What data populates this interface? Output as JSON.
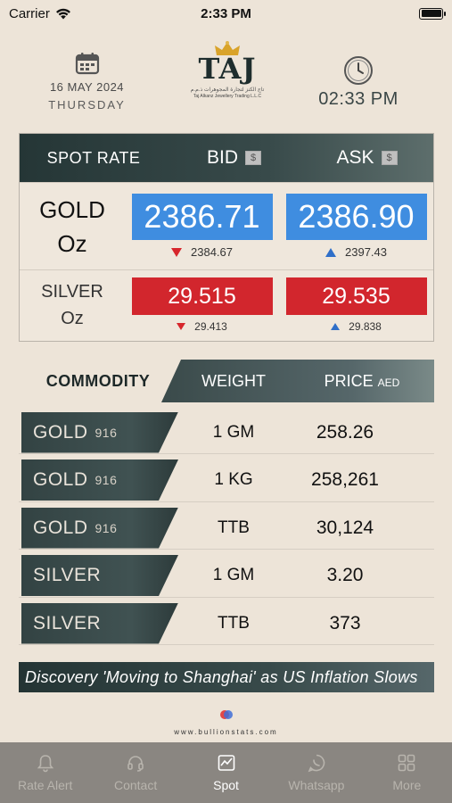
{
  "status_bar": {
    "carrier": "Carrier",
    "time": "2:33 PM"
  },
  "header": {
    "date": "16 MAY 2024",
    "day": "THURSDAY",
    "logo_text": "TAJ",
    "logo_sub_ar": "تاج الكنز لتجارة المجوهرات ذ.م.م",
    "logo_sub_en": "Taj Alkanz Jewellery Trading L.L.C",
    "time": "02:33 PM"
  },
  "spot": {
    "header": {
      "label": "SPOT RATE",
      "bid": "BID",
      "ask": "ASK",
      "currency_symbol": "$"
    },
    "rows": [
      {
        "name_line1": "GOLD",
        "name_line2": "Oz",
        "bid": "2386.71",
        "ask": "2386.90",
        "bid_low": "2384.67",
        "ask_high": "2397.43"
      },
      {
        "name_line1": "SILVER",
        "name_line2": "Oz",
        "bid": "29.515",
        "ask": "29.535",
        "bid_low": "29.413",
        "ask_high": "29.838"
      }
    ]
  },
  "commodity": {
    "header": {
      "commodity": "COMMODITY",
      "weight": "WEIGHT",
      "price": "PRICE",
      "currency": "AED"
    },
    "rows": [
      {
        "name": "GOLD",
        "purity": "916",
        "weight": "1 GM",
        "price": "258.26"
      },
      {
        "name": "GOLD",
        "purity": "916",
        "weight": "1 KG",
        "price": "258,261"
      },
      {
        "name": "GOLD",
        "purity": "916",
        "weight": "TTB",
        "price": "30,124"
      },
      {
        "name": "SILVER",
        "purity": "",
        "weight": "1 GM",
        "price": "3.20"
      },
      {
        "name": "SILVER",
        "purity": "",
        "weight": "TTB",
        "price": "373"
      }
    ]
  },
  "ticker": {
    "text": "Discovery 'Moving to Shanghai' as US Inflation Slows"
  },
  "branding": {
    "text": "www.bullionstats.com"
  },
  "tabbar": {
    "tabs": [
      {
        "label": "Rate Alert",
        "icon": "bell-icon"
      },
      {
        "label": "Contact",
        "icon": "headset-icon"
      },
      {
        "label": "Spot",
        "icon": "chart-icon"
      },
      {
        "label": "Whatsapp",
        "icon": "whatsapp-icon"
      },
      {
        "label": "More",
        "icon": "grid-icon"
      }
    ],
    "active": "Spot"
  },
  "colors": {
    "background": "#ede4d8",
    "header_dark": "#2d3d3d",
    "bid_ask_gold": "#3f8de0",
    "bid_ask_silver": "#d2262d",
    "down": "#d7262c",
    "up": "#2f6fc8",
    "tabbar": "#8a8681"
  }
}
